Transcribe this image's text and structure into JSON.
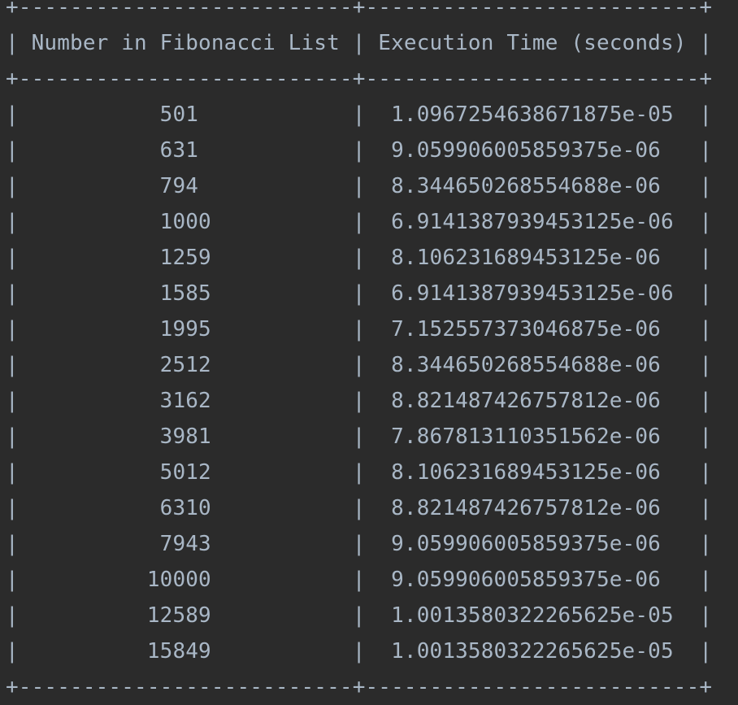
{
  "table": {
    "headers": [
      "Number in Fibonacci List",
      "Execution Time (seconds)"
    ],
    "rows": [
      [
        "501",
        "1.0967254638671875e-05"
      ],
      [
        "631",
        "9.059906005859375e-06"
      ],
      [
        "794",
        "8.344650268554688e-06"
      ],
      [
        "1000",
        "6.9141387939453125e-06"
      ],
      [
        "1259",
        "8.106231689453125e-06"
      ],
      [
        "1585",
        "6.9141387939453125e-06"
      ],
      [
        "1995",
        "7.152557373046875e-06"
      ],
      [
        "2512",
        "8.344650268554688e-06"
      ],
      [
        "3162",
        "8.821487426757812e-06"
      ],
      [
        "3981",
        "7.867813110351562e-06"
      ],
      [
        "5012",
        "8.106231689453125e-06"
      ],
      [
        "6310",
        "8.821487426757812e-06"
      ],
      [
        "7943",
        "9.059906005859375e-06"
      ],
      [
        "10000",
        "9.059906005859375e-06"
      ],
      [
        "12589",
        "1.0013580322265625e-05"
      ],
      [
        "15849",
        "1.0013580322265625e-05"
      ]
    ]
  }
}
